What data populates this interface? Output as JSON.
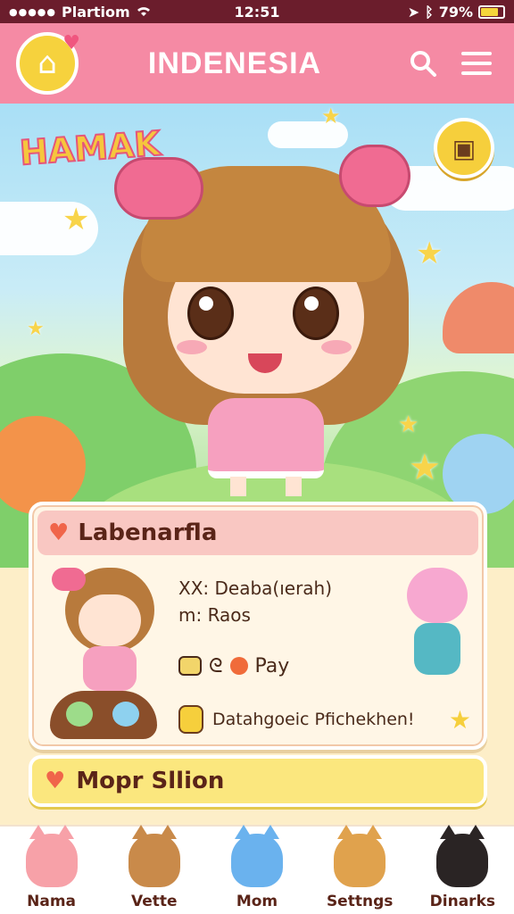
{
  "status_bar": {
    "signal_dots": "●●●●●",
    "carrier": "Plartiom",
    "wifi_icon": "wifi-icon",
    "time": "12:51",
    "battery": "79%",
    "battery_level": 0.79
  },
  "header": {
    "title": "INDENESIA",
    "logo_icon": "house-heart-icon",
    "search_icon": "search-icon",
    "menu_icon": "hamburger-menu-icon"
  },
  "hero": {
    "banner": "HAMAK"
  },
  "profile_card": {
    "title": "Labenarfla",
    "line1": "XX: Deaba(ıerah)",
    "line2": "m: Raos",
    "pay": "Pay",
    "footer": "Datahgoeic Pfichekhen!"
  },
  "second_card": {
    "title": "Mopr Sllion"
  },
  "bottom_nav": {
    "items": [
      {
        "label": "Nama",
        "color": "#f7a1a8"
      },
      {
        "label": "Vette",
        "color": "#c98a4a"
      },
      {
        "label": "Mom",
        "color": "#6ab2ee"
      },
      {
        "label": "Settngs",
        "color": "#e0a24d"
      },
      {
        "label": "Dinarks",
        "color": "#2a2424"
      }
    ]
  },
  "colors": {
    "header": "#f58aa4",
    "accent_yellow": "#f6cf3c",
    "text_brown": "#5a2418"
  }
}
